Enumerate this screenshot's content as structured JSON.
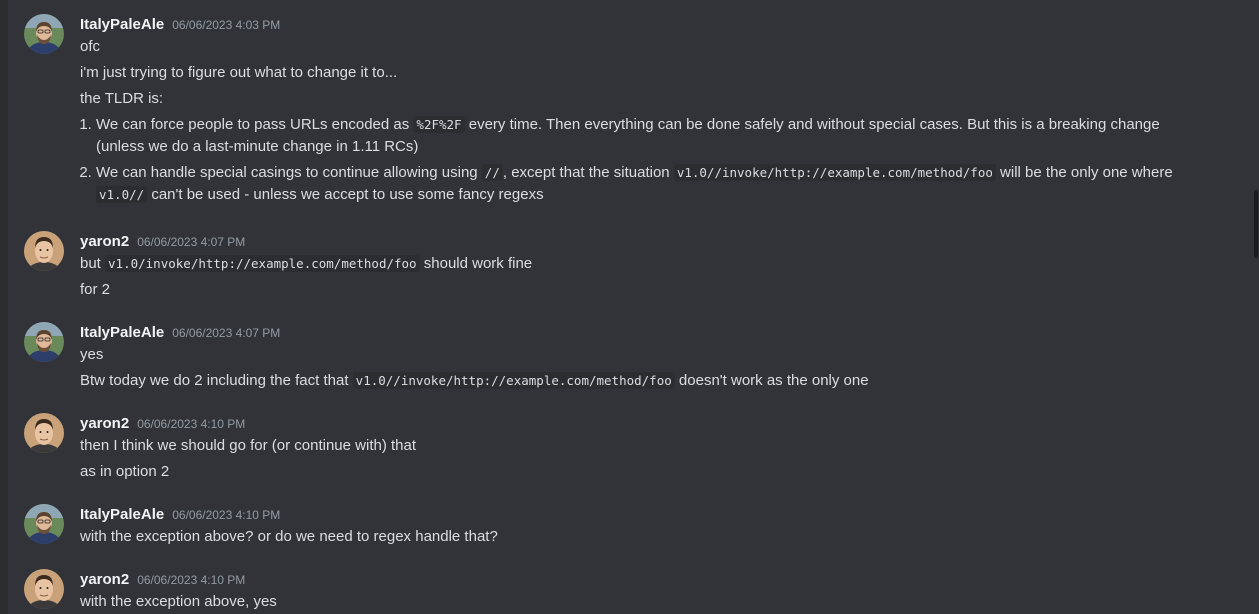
{
  "messages": [
    {
      "author": "ItalyPaleAle",
      "timestamp": "06/06/2023 4:03 PM",
      "lines": [
        "ofc",
        "i'm just trying to figure out what to change it to...",
        "the TLDR is:"
      ],
      "list": [
        {
          "before": "We can force people to pass URLs encoded as ",
          "code": "%2F%2F",
          "after": " every time. Then everything can be done safely and without special cases. But this is a breaking change (unless we do a last-minute change in 1.11 RCs)"
        },
        {
          "before": "We can handle special casings to continue allowing using ",
          "code": "//",
          "mid": ", except that the situation ",
          "code2": "v1.0//invoke/http://example.com/method/foo",
          "mid2": " will be the only one where ",
          "code3": "v1.0//",
          "after": "  can't be used - unless we accept to use some fancy regexs"
        }
      ]
    },
    {
      "author": "yaron2",
      "timestamp": "06/06/2023 4:07 PM",
      "line1_before": "but ",
      "line1_code": "v1.0/invoke/http://example.com/method/foo",
      "line1_after": " should work fine",
      "line2": "for 2"
    },
    {
      "author": "ItalyPaleAle",
      "timestamp": "06/06/2023 4:07 PM",
      "line1": "yes",
      "line2_before": "Btw today we do 2 including the fact that ",
      "line2_code": "v1.0//invoke/http://example.com/method/foo",
      "line2_after": " doesn't work as the only one"
    },
    {
      "author": "yaron2",
      "timestamp": "06/06/2023 4:10 PM",
      "line1": "then I think we should go for (or continue with) that",
      "line2": "as in option 2"
    },
    {
      "author": "ItalyPaleAle",
      "timestamp": "06/06/2023 4:10 PM",
      "line1": "with the exception above? or do we need to regex handle that?"
    },
    {
      "author": "yaron2",
      "timestamp": "06/06/2023 4:10 PM",
      "line1": "with the exception above, yes"
    }
  ],
  "colors": {
    "background": "#313338",
    "text": "#dbdee1",
    "author": "#f2f3f5",
    "timestamp": "#949ba4",
    "code_bg": "#2b2d31"
  },
  "icons": {
    "avatar_italy": "avatar-bearded-man-glasses",
    "avatar_yaron": "avatar-man-short-hair"
  }
}
